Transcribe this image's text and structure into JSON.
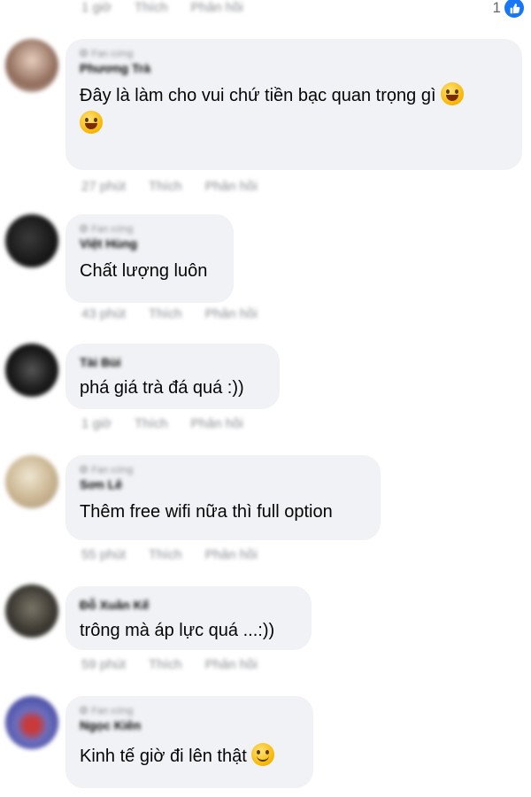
{
  "top": {
    "time": "1 giờ",
    "like_label": "Thích",
    "reply_label": "Phản hồi",
    "reaction_count": "1"
  },
  "comments": [
    {
      "badge": "Fan cứng",
      "author": "Phương Trà",
      "text_before": "Đây là làm cho vui chứ tiền bạc quan trọng gì",
      "text_after": "",
      "emojis": [
        "rolling-laughing",
        "rolling-laughing"
      ],
      "time": "27 phút",
      "like_label": "Thích",
      "reply_label": "Phản hồi"
    },
    {
      "badge": "Fan cứng",
      "author": "Việt Hùng",
      "text_before": "Chất lượng luôn",
      "time": "43 phút",
      "like_label": "Thích",
      "reply_label": "Phản hồi"
    },
    {
      "badge": "",
      "author": "Tài Bùi",
      "text_before": "phá giá trà đá quá :))",
      "time": "1 giờ",
      "like_label": "Thích",
      "reply_label": "Phản hồi"
    },
    {
      "badge": "Fan cứng",
      "author": "Sơn Lê",
      "text_before": "Thêm free wifi nữa thì full option",
      "time": "55 phút",
      "like_label": "Thích",
      "reply_label": "Phản hồi"
    },
    {
      "badge": "",
      "author": "Đỗ Xuân Kế",
      "text_before": "trông mà áp lực quá ...:))",
      "time": "59 phút",
      "like_label": "Thích",
      "reply_label": "Phản hồi"
    },
    {
      "badge": "Fan cứng",
      "author": "Ngọc Kiên",
      "text_before": "Kinh tế giờ đi lên thật",
      "emojis": [
        "slightly-smiling"
      ],
      "time": "",
      "like_label": "",
      "reply_label": ""
    }
  ],
  "colors": {
    "bubble": "#f0f2f5",
    "meta": "#8a8d91",
    "like_badge": "#1877f2"
  }
}
